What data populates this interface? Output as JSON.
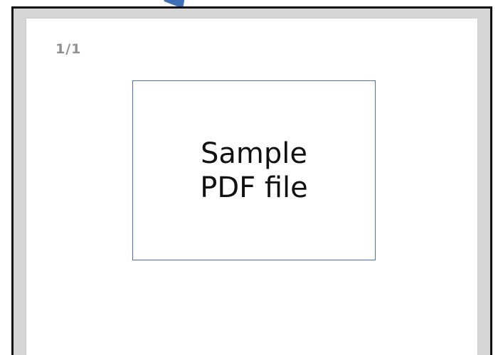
{
  "viewer": {
    "page_counter": "1/1"
  },
  "document": {
    "line1": "Sample",
    "line2": "PDF file"
  },
  "colors": {
    "frame_border": "#111111",
    "box_border": "#4a72b0",
    "arrow": "#3f6fb5",
    "counter_text": "#909090"
  },
  "icons": {
    "arrow": "arrow-icon"
  }
}
